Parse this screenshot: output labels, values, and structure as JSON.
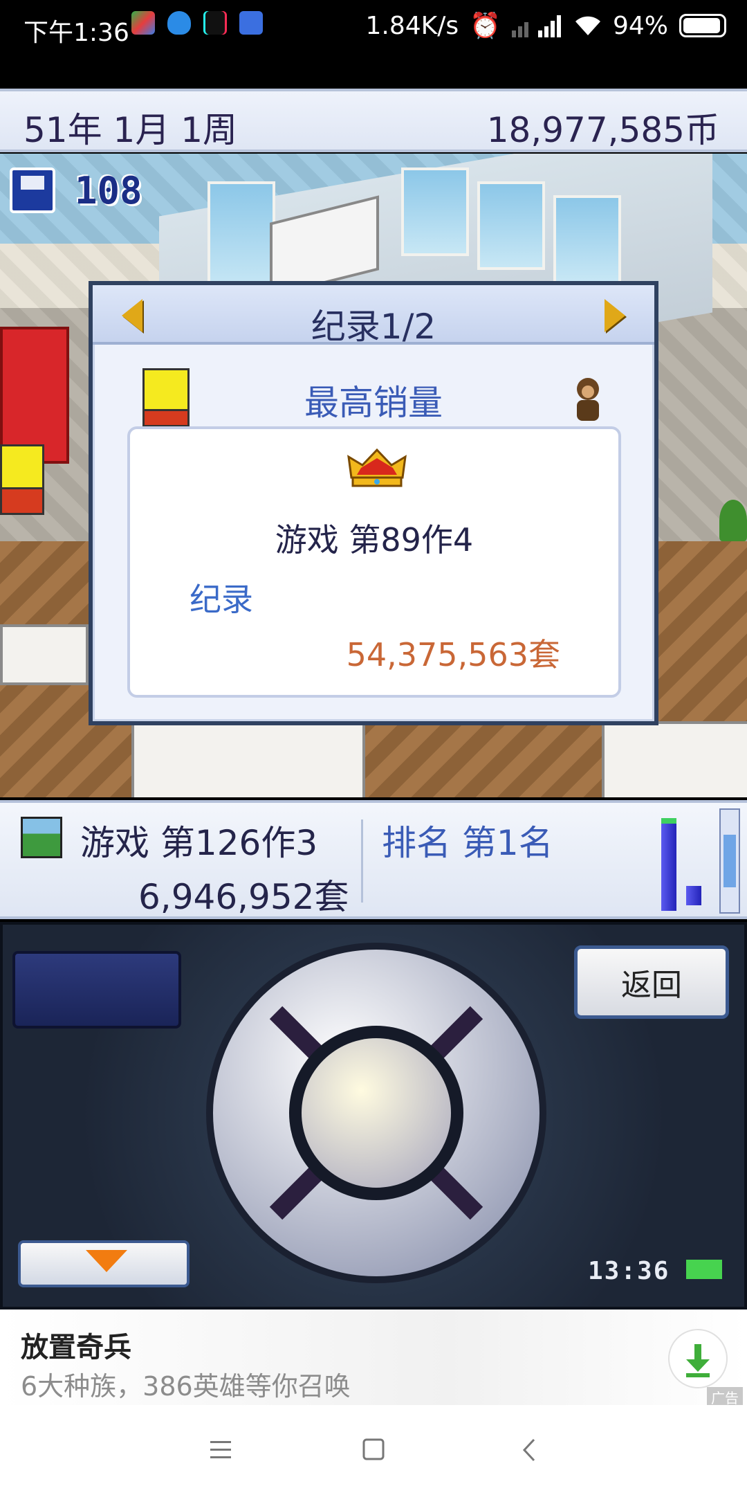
{
  "status_bar": {
    "time": "下午1:36",
    "network_speed": "1.84K/s",
    "battery": "94%",
    "app_icons": [
      "notification-app-icon",
      "qq-icon",
      "tiktok-icon",
      "app-icon"
    ]
  },
  "top_bar": {
    "date": "51年 1月 1周",
    "money": "18,977,585币"
  },
  "hud": {
    "save_count": "108"
  },
  "dialog": {
    "title": "纪录1/2",
    "category": "最高销量",
    "game_name": "游戏 第89作4",
    "record_label": "纪录",
    "record_value": "54,375,563套"
  },
  "info_strip": {
    "current_game": "游戏 第126作3",
    "current_sales": "6,946,952套",
    "rank": "排名 第1名",
    "bars": [
      1.0,
      0.2
    ]
  },
  "controller": {
    "back_label": "返回",
    "clock": "13:36",
    "battery_level": 1.0
  },
  "ad": {
    "title": "放置奇兵",
    "description": "6大种族，386英雄等你召唤",
    "tag": "广告"
  },
  "colors": {
    "accent_blue": "#3a5bb6",
    "record_orange": "#c96736",
    "dialog_border": "#2f4160"
  }
}
